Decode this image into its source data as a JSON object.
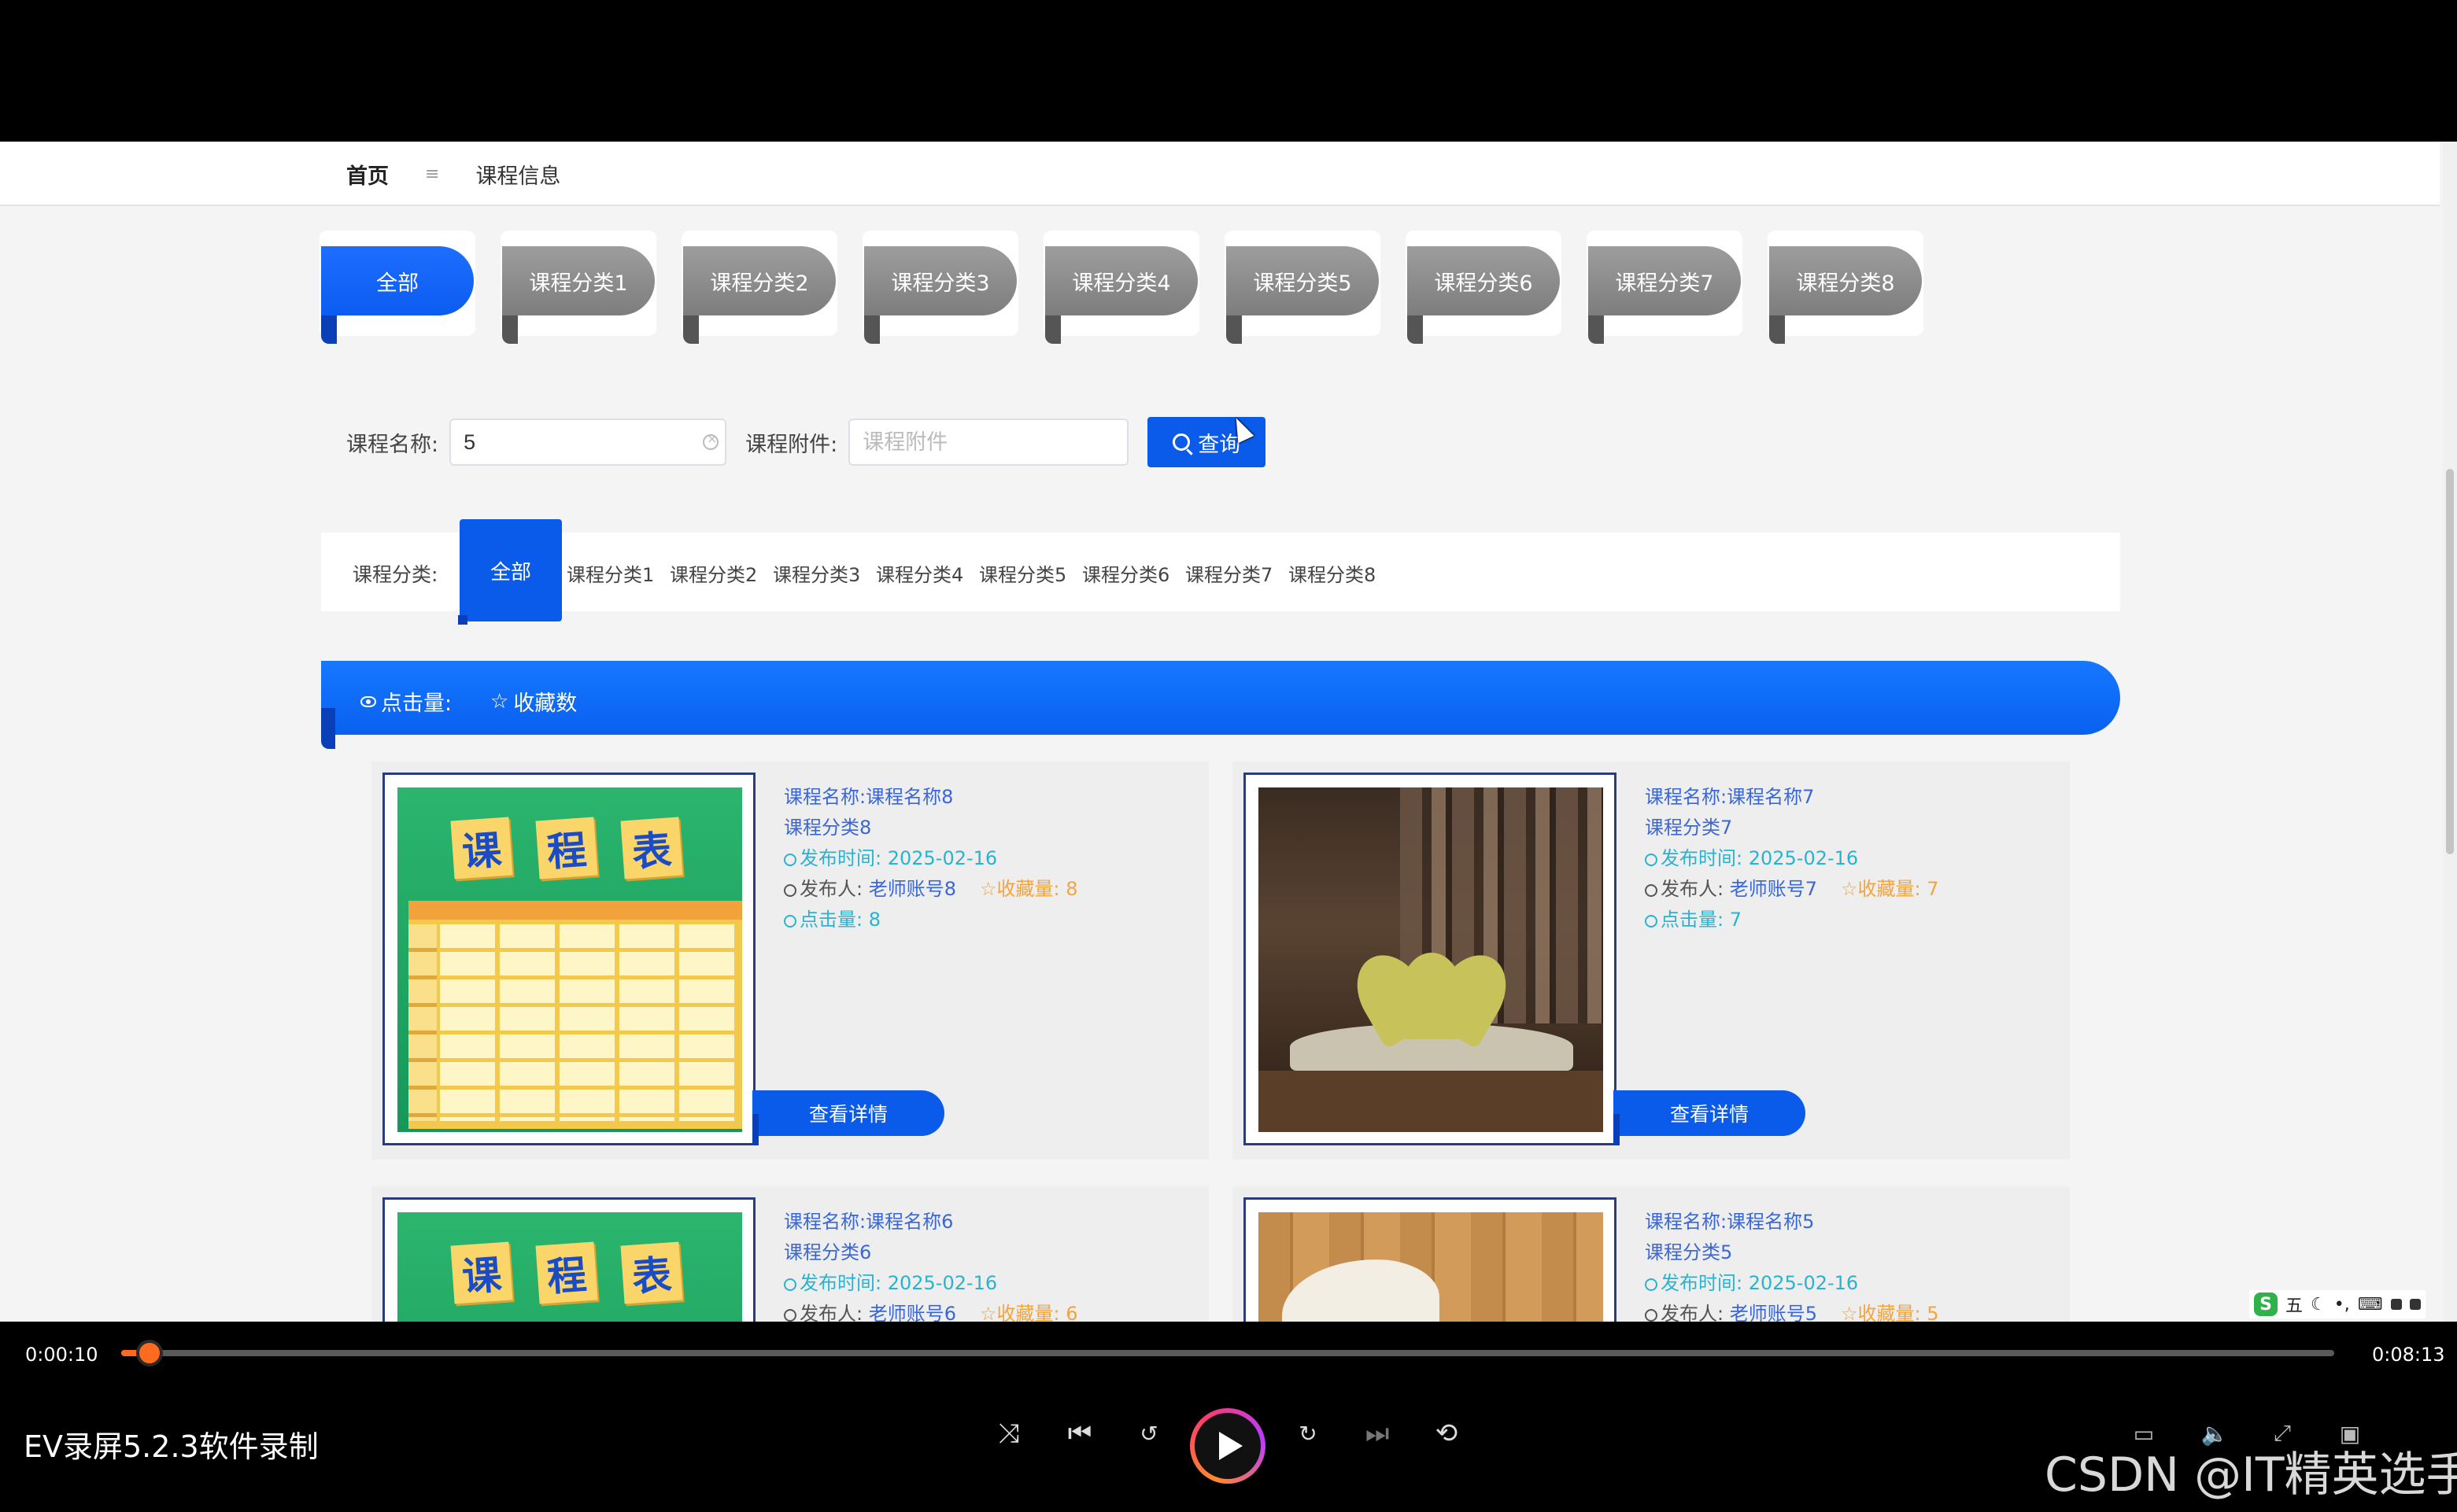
{
  "breadcrumb": {
    "home": "首页",
    "separator": "≡",
    "current": "课程信息"
  },
  "category_tabs": [
    {
      "label": "全部",
      "active": true
    },
    {
      "label": "课程分类1",
      "active": false
    },
    {
      "label": "课程分类2",
      "active": false
    },
    {
      "label": "课程分类3",
      "active": false
    },
    {
      "label": "课程分类4",
      "active": false
    },
    {
      "label": "课程分类5",
      "active": false
    },
    {
      "label": "课程分类6",
      "active": false
    },
    {
      "label": "课程分类7",
      "active": false
    },
    {
      "label": "课程分类8",
      "active": false
    }
  ],
  "search": {
    "name_label": "课程名称:",
    "name_value": "5",
    "attachment_label": "课程附件:",
    "attachment_placeholder": "课程附件",
    "button_label": "查询"
  },
  "filter": {
    "label": "课程分类:",
    "all": "全部",
    "items": [
      "课程分类1",
      "课程分类2",
      "课程分类3",
      "课程分类4",
      "课程分类5",
      "课程分类6",
      "课程分类7",
      "课程分类8"
    ]
  },
  "sort": {
    "views": "点击量:",
    "favorites": "收藏数"
  },
  "cards": [
    {
      "name": "课程名称:课程名称8",
      "category": "课程分类8",
      "publish": "发布时间: 2025-02-16",
      "poster_label": "发布人:",
      "poster": "老师账号8",
      "favorites": "收藏量: 8",
      "views": "点击量: 8",
      "detail": "查看详情",
      "thumb": "schedule"
    },
    {
      "name": "课程名称:课程名称7",
      "category": "课程分类7",
      "publish": "发布时间: 2025-02-16",
      "poster_label": "发布人:",
      "poster": "老师账号7",
      "favorites": "收藏量: 7",
      "views": "点击量: 7",
      "detail": "查看详情",
      "thumb": "book"
    },
    {
      "name": "课程名称:课程名称6",
      "category": "课程分类6",
      "publish": "发布时间: 2025-02-16",
      "poster_label": "发布人:",
      "poster": "老师账号6",
      "favorites": "收藏量: 6",
      "views": "",
      "detail": "",
      "thumb": "schedule"
    },
    {
      "name": "课程名称:课程名称5",
      "category": "课程分类5",
      "publish": "发布时间: 2025-02-16",
      "poster_label": "发布人:",
      "poster": "老师账号5",
      "favorites": "收藏量: 5",
      "views": "",
      "detail": "",
      "thumb": "wood"
    }
  ],
  "schedule_art": {
    "chars": [
      "课",
      "程",
      "表"
    ]
  },
  "ime": {
    "mode": "五"
  },
  "player": {
    "current_time": "0:00:10",
    "total_time": "0:08:13",
    "progress": 0.0128,
    "title": "EV录屏5.2.3软件录制",
    "accent_color": "#ff6a21"
  },
  "watermark": "CSDN @IT精英选手"
}
